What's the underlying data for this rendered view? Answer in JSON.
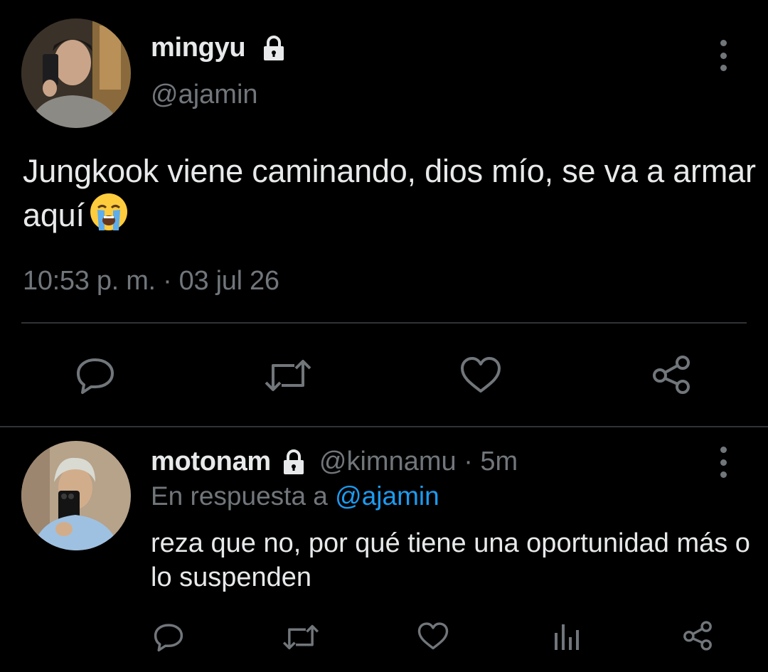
{
  "tweet": {
    "author": {
      "display_name": "mingyu",
      "handle": "@ajamin",
      "avatar": "profile-photo",
      "protected_icon": "lock-icon"
    },
    "text": "Jungkook viene caminando, dios mío, se va a armar aquí",
    "emoji": "loudly-crying-face-emoji",
    "timestamp": "10:53 p. m. · 03 jul 26",
    "actions": [
      "reply-icon",
      "retweet-icon",
      "like-icon",
      "share-icon"
    ]
  },
  "reply": {
    "author": {
      "display_name": "motonam",
      "handle_time": "@kimnamu · 5m",
      "avatar": "profile-photo",
      "protected_icon": "lock-icon"
    },
    "in_reply_prefix": "En respuesta a",
    "in_reply_mention": "@ajamin",
    "text": "reza que no, por qué tiene una oportunidad más o lo suspenden",
    "actions": [
      "reply-icon",
      "retweet-icon",
      "like-icon",
      "analytics-icon",
      "share-icon"
    ]
  },
  "colors": {
    "background": "#000000",
    "text_primary": "#e7e9ea",
    "text_secondary": "#71767b",
    "link": "#1d9bf0",
    "divider": "#2f3336"
  }
}
